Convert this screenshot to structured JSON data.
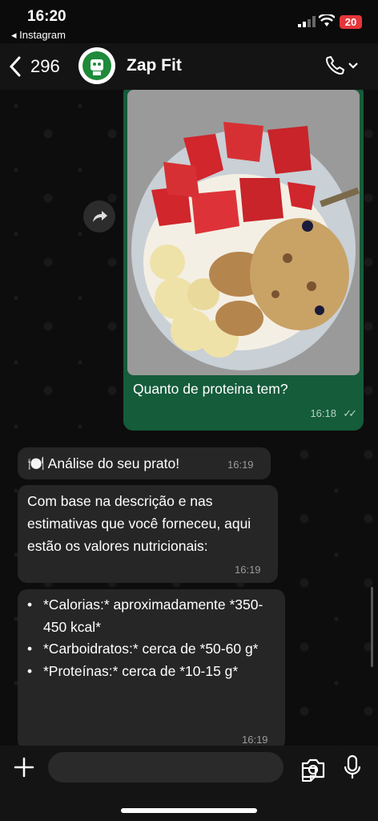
{
  "status_bar": {
    "time": "16:20",
    "back_app": "◂ Instagram",
    "battery": "20"
  },
  "header": {
    "unread_count": "296",
    "contact_name": "Zap Fit"
  },
  "messages": {
    "outgoing": {
      "text": "Quanto de proteina tem?",
      "time": "16:18"
    },
    "incoming": [
      {
        "text": "🍽️ Análise do seu prato!",
        "time": "16:19"
      },
      {
        "text": "Com base na descrição e nas estimativas que você forneceu, aqui estão os valores nutricionais:",
        "time": "16:19"
      }
    ],
    "nutrition": {
      "items": [
        "*Calorias:* aproximadamente *350-450 kcal*",
        "*Carboidratos:* cerca de *50-60 g*",
        "*Proteínas:* cerca de *10-15 g*"
      ],
      "time": "16:19"
    }
  },
  "icons": {
    "back": "chevron-left-icon",
    "call": "phone-icon",
    "forward": "forward-icon",
    "attach": "plus-icon",
    "sticker": "sticker-icon",
    "camera": "camera-icon",
    "mic": "mic-icon"
  },
  "colors": {
    "outgoing_bubble": "#155c3a",
    "incoming_bubble": "#262626",
    "battery": "#e5363a"
  }
}
